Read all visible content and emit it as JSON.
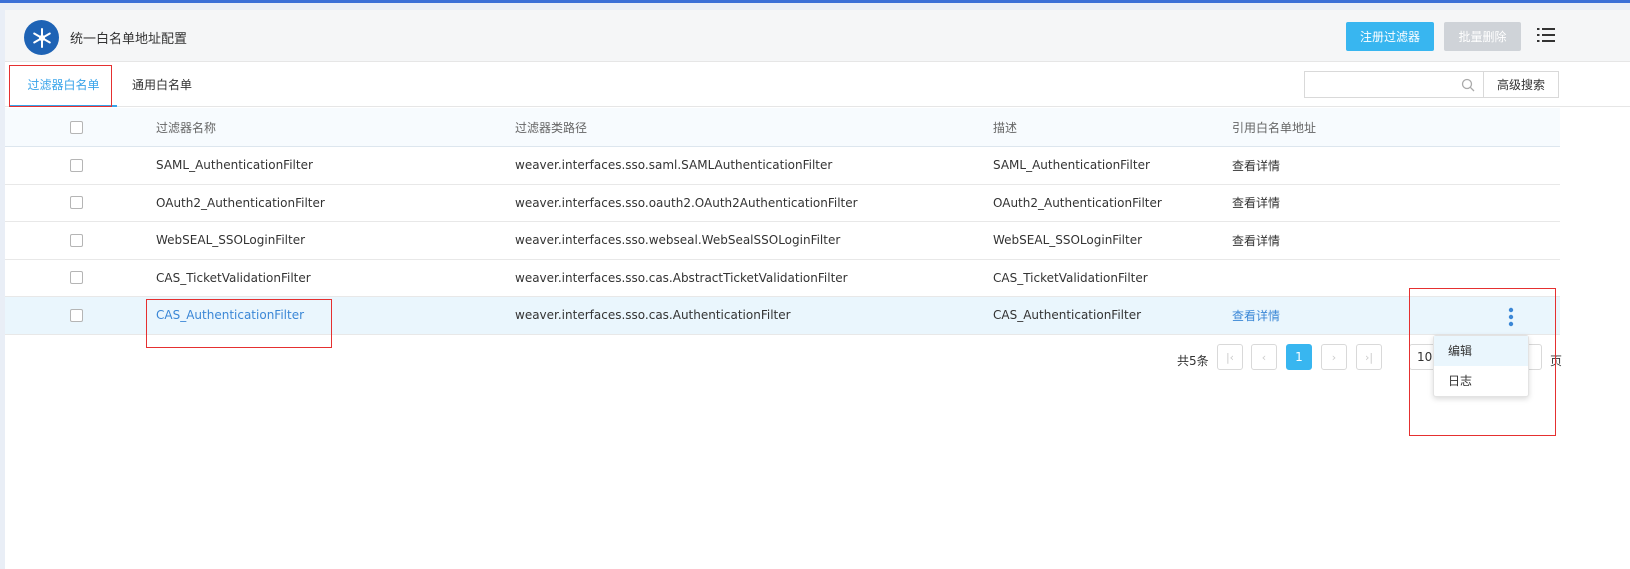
{
  "header": {
    "title": "统一白名单地址配置",
    "register_label": "注册过滤器",
    "batch_delete_label": "批量删除"
  },
  "tabs": [
    {
      "label": "过滤器白名单",
      "active": true
    },
    {
      "label": "通用白名单",
      "active": false
    }
  ],
  "search": {
    "placeholder": "",
    "advanced_label": "高级搜索"
  },
  "table": {
    "columns": [
      "过滤器名称",
      "过滤器类路径",
      "描述",
      "引用白名单地址"
    ],
    "rows": [
      {
        "name": "SAML_AuthenticationFilter",
        "path": "weaver.interfaces.sso.saml.SAMLAuthenticationFilter",
        "desc": "SAML_AuthenticationFilter",
        "ref": "查看详情"
      },
      {
        "name": "OAuth2_AuthenticationFilter",
        "path": "weaver.interfaces.sso.oauth2.OAuth2AuthenticationFilter",
        "desc": "OAuth2_AuthenticationFilter",
        "ref": "查看详情"
      },
      {
        "name": "WebSEAL_SSOLoginFilter",
        "path": "weaver.interfaces.sso.webseal.WebSealSSOLoginFilter",
        "desc": "WebSEAL_SSOLoginFilter",
        "ref": "查看详情"
      },
      {
        "name": "CAS_TicketValidationFilter",
        "path": "weaver.interfaces.sso.cas.AbstractTicketValidationFilter",
        "desc": "CAS_TicketValidationFilter",
        "ref": ""
      },
      {
        "name": "CAS_AuthenticationFilter",
        "path": "weaver.interfaces.sso.cas.AuthenticationFilter",
        "desc": "CAS_AuthenticationFilter",
        "ref": "查看详情"
      }
    ]
  },
  "pagination": {
    "total_label": "共5条",
    "current_page": "1",
    "page_size": "10",
    "page_label": "页"
  },
  "dropdown": {
    "items": [
      "编辑",
      "日志"
    ]
  },
  "colors": {
    "primary": "#38b6f0",
    "link": "#3b87d6",
    "annotation": "#e53030",
    "logo": "#1e63b5"
  }
}
